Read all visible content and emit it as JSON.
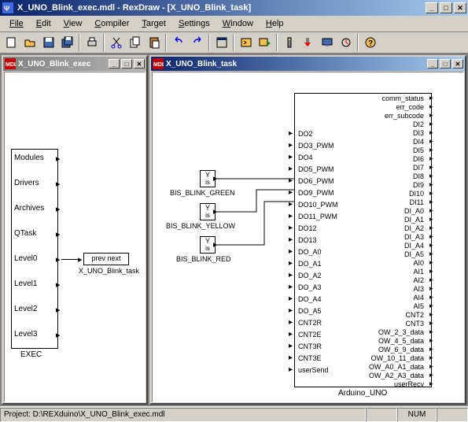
{
  "window": {
    "title": "X_UNO_Blink_exec.mdl - RexDraw - [X_UNO_Blink_task]",
    "min_label": "_",
    "max_label": "□",
    "close_label": "✕"
  },
  "menu": {
    "file": "File",
    "edit": "Edit",
    "view": "View",
    "compiler": "Compiler",
    "target": "Target",
    "settings": "Settings",
    "window": "Window",
    "help": "Help"
  },
  "left_child": {
    "title": "X_UNO_Blink_exec"
  },
  "right_child": {
    "title": "X_UNO_Blink_task"
  },
  "exec_block": {
    "label": "EXEC",
    "ports": [
      "Modules",
      "Drivers",
      "Archives",
      "QTask",
      "Level0",
      "Level1",
      "Level2",
      "Level3"
    ],
    "link_box": "prev  next",
    "link_label": "X_UNO_Blink_task"
  },
  "bis_blocks": {
    "y_label": "Y",
    "is_label": "is",
    "green": "BIS_BLINK_GREEN",
    "yellow": "BIS_BLINK_YELLOW",
    "red": "BIS_BLINK_RED"
  },
  "arduino": {
    "label": "Arduino_UNO",
    "left_ports": [
      "DO2",
      "DO3_PWM",
      "DO4",
      "DO5_PWM",
      "DO6_PWM",
      "DO9_PWM",
      "DO10_PWM",
      "DO11_PWM",
      "DO12",
      "DO13",
      "DO_A0",
      "DO_A1",
      "DO_A2",
      "DO_A3",
      "DO_A4",
      "DO_A5",
      "CNT2R",
      "CNT2E",
      "CNT3R",
      "CNT3E",
      "userSend"
    ],
    "right_ports": [
      "comm_status",
      "err_code",
      "err_subcode",
      "DI2",
      "DI3",
      "DI4",
      "DI5",
      "DI6",
      "DI7",
      "DI8",
      "DI9",
      "DI10",
      "DI11",
      "DI_A0",
      "DI_A1",
      "DI_A2",
      "DI_A3",
      "DI_A4",
      "DI_A5",
      "AI0",
      "AI1",
      "AI2",
      "AI3",
      "AI4",
      "AI5",
      "CNT2",
      "CNT3",
      "OW_2_3_data",
      "OW_4_5_data",
      "OW_6_9_data",
      "OW_10_11_data",
      "OW_A0_A1_data",
      "OW_A2_A3_data",
      "userRecv"
    ]
  },
  "statusbar": {
    "project": "Project: D:\\REXduino\\X_UNO_Blink_exec.mdl",
    "num": "NUM"
  }
}
